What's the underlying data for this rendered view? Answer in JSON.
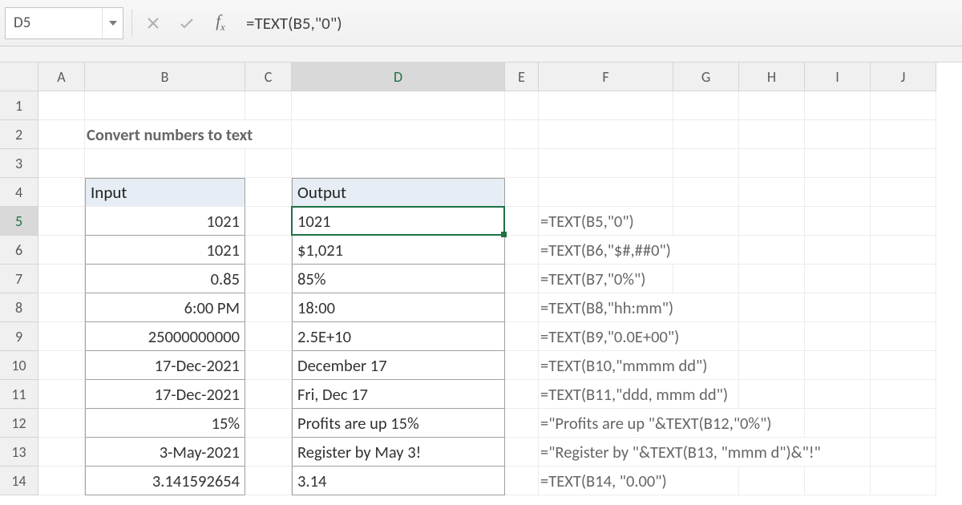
{
  "namebox": {
    "value": "D5"
  },
  "formula_bar": {
    "formula": "=TEXT(B5,\"0\")"
  },
  "columns": [
    "A",
    "B",
    "C",
    "D",
    "E",
    "F",
    "G",
    "H",
    "I",
    "J"
  ],
  "row_labels": [
    "1",
    "2",
    "3",
    "4",
    "5",
    "6",
    "7",
    "8",
    "9",
    "10",
    "11",
    "12",
    "13",
    "14"
  ],
  "active": {
    "col": "D",
    "row": "5"
  },
  "title": "Convert numbers to text",
  "headers": {
    "input": "Input",
    "output": "Output"
  },
  "rows": [
    {
      "input": "1021",
      "output": "1021",
      "formula": "=TEXT(B5,\"0\")"
    },
    {
      "input": "1021",
      "output": "$1,021",
      "formula": "=TEXT(B6,\"$#,##0\")"
    },
    {
      "input": "0.85",
      "output": "85%",
      "formula": "=TEXT(B7,\"0%\")"
    },
    {
      "input": "6:00 PM",
      "output": "18:00",
      "formula": "=TEXT(B8,\"hh:mm\")"
    },
    {
      "input": "25000000000",
      "output": "2.5E+10",
      "formula": "=TEXT(B9,\"0.0E+00\")"
    },
    {
      "input": "17-Dec-2021",
      "output": "December 17",
      "formula": "=TEXT(B10,\"mmmm dd\")"
    },
    {
      "input": "17-Dec-2021",
      "output": "Fri, Dec 17",
      "formula": "=TEXT(B11,\"ddd, mmm dd\")"
    },
    {
      "input": "15%",
      "output": "Profits are up 15%",
      "formula": "=\"Profits are up \"&TEXT(B12,\"0%\")"
    },
    {
      "input": "3-May-2021",
      "output": "Register by May 3!",
      "formula": "=\"Register by \"&TEXT(B13, \"mmm d\")&\"!\""
    },
    {
      "input": "3.141592654",
      "output": "3.14",
      "formula": "=TEXT(B14, \"0.00\")"
    }
  ]
}
